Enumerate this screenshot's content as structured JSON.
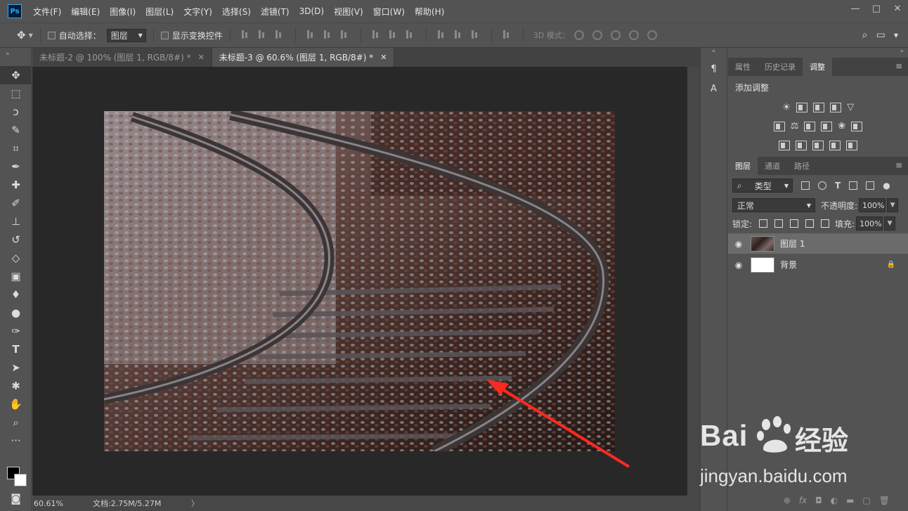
{
  "app": {
    "logo": "Ps"
  },
  "menu": [
    "文件(F)",
    "编辑(E)",
    "图像(I)",
    "图层(L)",
    "文字(Y)",
    "选择(S)",
    "滤镜(T)",
    "3D(D)",
    "视图(V)",
    "窗口(W)",
    "帮助(H)"
  ],
  "window_controls": {
    "minimize": "—",
    "restore": "□",
    "close": "✕"
  },
  "options": {
    "auto_select_label": "自动选择：",
    "auto_select_value": "图层",
    "show_transform_label": "显示变换控件",
    "mode_3d_label": "3D 模式："
  },
  "tabs": [
    {
      "label": "未标题-2 @ 100% (图层 1, RGB/8#) *",
      "close": "✕"
    },
    {
      "label": "未标题-3 @ 60.6% (图层 1, RGB/8#) *",
      "close": "✕"
    }
  ],
  "status": {
    "zoom": "60.61%",
    "doc": "文档:2.75M/5.27M",
    "arrow": "〉"
  },
  "panels": {
    "top_tabs": [
      "属性",
      "历史记录",
      "调整"
    ],
    "adjust_title": "添加调整",
    "layer_tabs": [
      "图层",
      "通道",
      "路径"
    ],
    "filter_kind": "类型",
    "blend_mode": "正常",
    "opacity_label": "不透明度:",
    "opacity_value": "100%",
    "lock_label": "锁定:",
    "fill_label": "填充:",
    "fill_value": "100%",
    "layers": [
      {
        "name": "图层 1",
        "active": true,
        "locked": false
      },
      {
        "name": "背景",
        "active": false,
        "locked": true
      }
    ]
  },
  "watermark": {
    "brand": "Bai",
    "brand2": "经验",
    "url": "jingyan.baidu.com"
  },
  "colors": {
    "arrow": "#ff2a1f",
    "canvas_bg": "#282828",
    "panel_bg": "#535353"
  }
}
